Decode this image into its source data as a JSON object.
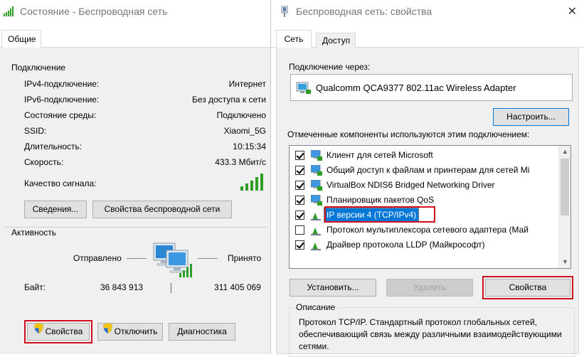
{
  "status_window": {
    "title": "Состояние - Беспроводная сеть",
    "tab": "Общие",
    "connection": {
      "header": "Подключение",
      "rows": [
        {
          "label": "IPv4-подключение:",
          "value": "Интернет"
        },
        {
          "label": "IPv6-подключение:",
          "value": "Без доступа к сети"
        },
        {
          "label": "Состояние среды:",
          "value": "Подключено"
        },
        {
          "label": "SSID:",
          "value": "Xiaomi_5G"
        },
        {
          "label": "Длительность:",
          "value": "10:15:34"
        },
        {
          "label": "Скорость:",
          "value": "433.3 Мбит/с"
        }
      ],
      "signal_label": "Качество сигнала:",
      "signal_bars_level": 5,
      "details_button": "Сведения...",
      "wireless_props_button": "Свойства беспроводной сети"
    },
    "activity": {
      "header": "Активность",
      "sent_label": "Отправлено",
      "received_label": "Принято",
      "bytes_label": "Байт:",
      "bytes_sent": "36 843 913",
      "bytes_received": "311 405 069"
    },
    "buttons": {
      "properties": "Свойства",
      "disable": "Отключить",
      "diagnose": "Диагностика"
    }
  },
  "properties_window": {
    "title": "Беспроводная сеть: свойства",
    "tabs": [
      "Сеть",
      "Доступ"
    ],
    "connect_using_label": "Подключение через:",
    "adapter_name": "Qualcomm QCA9377 802.11ac Wireless Adapter",
    "configure_button": "Настроить...",
    "components_label": "Отмеченные компоненты используются этим подключением:",
    "components": [
      {
        "label": "Клиент для сетей Microsoft",
        "checked": true,
        "icon": "network-client-icon"
      },
      {
        "label": "Общий доступ к файлам и принтерам для сетей Mi",
        "checked": true,
        "icon": "file-sharing-icon"
      },
      {
        "label": "VirtualBox NDIS6 Bridged Networking Driver",
        "checked": true,
        "icon": "network-driver-icon"
      },
      {
        "label": "Планировщик пакетов QoS",
        "checked": true,
        "icon": "qos-scheduler-icon"
      },
      {
        "label": "IP версии 4 (TCP/IPv4)",
        "checked": true,
        "icon": "protocol-icon",
        "selected": true
      },
      {
        "label": "Протокол мультиплексора сетевого адаптера (Май",
        "checked": false,
        "icon": "protocol-icon"
      },
      {
        "label": "Драйвер протокола LLDP (Майкрософт)",
        "checked": true,
        "icon": "protocol-icon"
      }
    ],
    "install_button": "Установить...",
    "remove_button": "Удалить",
    "properties_button": "Свойства",
    "description_header": "Описание",
    "description_text": "Протокол TCP/IP. Стандартный протокол глобальных сетей, обеспечивающий связь между различными взаимодействующими сетями."
  },
  "colors": {
    "highlight_border": "#d0101c",
    "selection": "#0078d7",
    "signal": "#2f9e25"
  }
}
